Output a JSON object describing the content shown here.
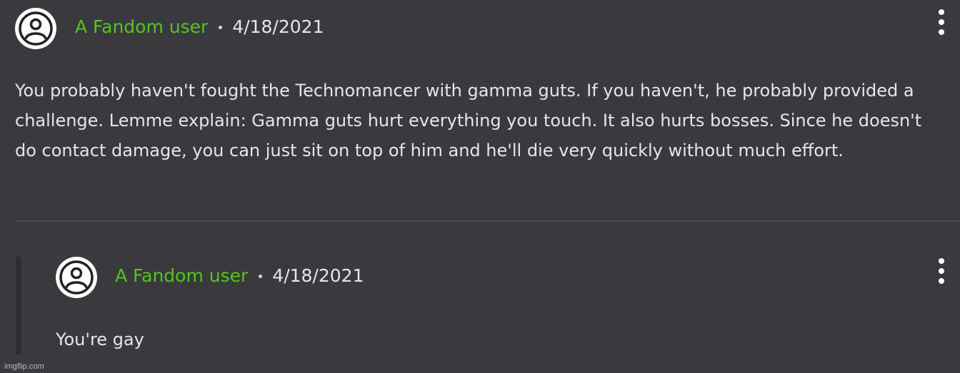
{
  "comment": {
    "author": "A Fandom user",
    "date": "4/18/2021",
    "text": "You probably haven't fought the Technomancer with gamma guts. If you haven't, he probably provided a challenge. Lemme explain: Gamma guts hurt everything you touch. It also hurts bosses. Since he doesn't do contact damage, you can just sit on top of him and he'll die very quickly without much effort."
  },
  "reply": {
    "author": "A Fandom user",
    "date": "4/18/2021",
    "text": "You're gay"
  },
  "watermark": "imgflip.com",
  "icons": {
    "avatar": "user-avatar-icon",
    "menu": "more-vertical-icon"
  },
  "colors": {
    "background": "#3a3a3e",
    "author": "#54c41d",
    "text": "#e6e6e6"
  }
}
